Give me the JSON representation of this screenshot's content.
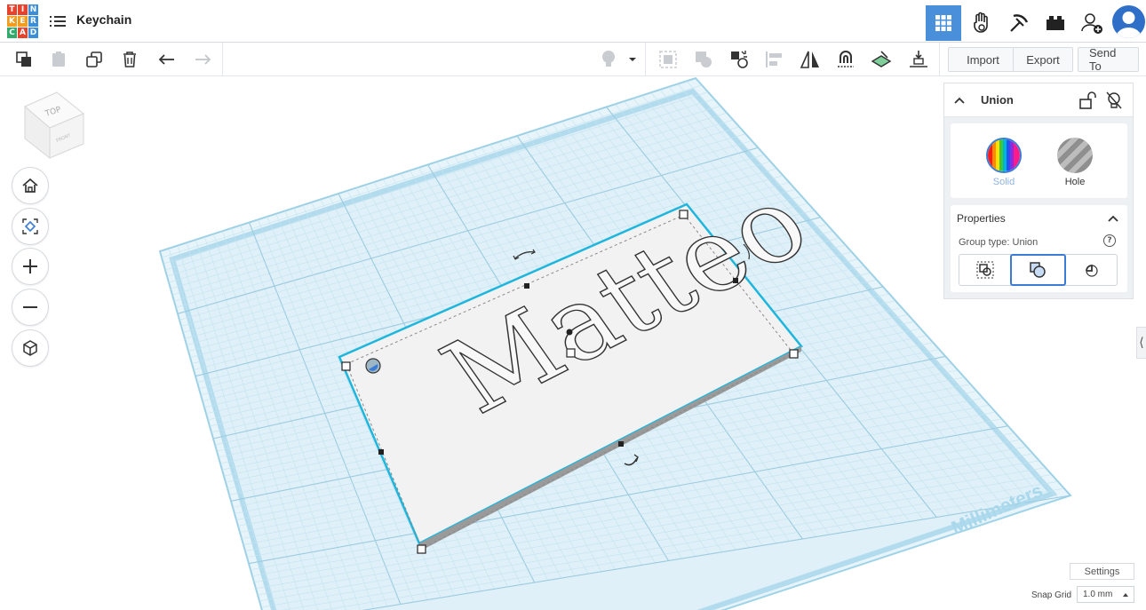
{
  "header": {
    "logo_letters": [
      "T",
      "I",
      "N",
      "K",
      "E",
      "R",
      "C",
      "A",
      "D"
    ],
    "logo_colors": [
      "#e8412c",
      "#e8412c",
      "#3b8fd8",
      "#f39c1e",
      "#f39c1e",
      "#3b8fd8",
      "#2fab6b",
      "#e8412c",
      "#3b8fd8"
    ],
    "title": "Keychain",
    "view_icons": [
      "grid-view-icon",
      "hand-sim-icon",
      "pickaxe-icon",
      "brick-icon",
      "add-user-icon",
      "user-avatar"
    ]
  },
  "toolbar": {
    "left_tools": [
      "copy-icon",
      "paste-icon",
      "duplicate-icon",
      "delete-icon",
      "undo-icon",
      "redo-icon"
    ],
    "right_tools": [
      "show-hide-icon",
      "dropdown-icon",
      "show-all-icon",
      "group-icon",
      "ungroup-icon",
      "align-icon",
      "mirror-icon",
      "cruise-icon",
      "workplane-icon",
      "drop-icon"
    ],
    "import_label": "Import",
    "export_label": "Export",
    "send_to_label": "Send To"
  },
  "workplane": {
    "units_label": "Millimeters",
    "viewcube_top": "TOP",
    "viewcube_front": "FRONT",
    "object_text": "Matteo"
  },
  "panel": {
    "shape_name": "Union",
    "solid_label": "Solid",
    "hole_label": "Hole",
    "properties_label": "Properties",
    "group_type_label": "Group type: Union",
    "group_type_options": [
      "hull-icon",
      "union-icon",
      "intersect-icon"
    ],
    "accent_color": "#3a7bd5"
  },
  "footer": {
    "settings_label": "Settings",
    "snap_grid_label": "Snap Grid",
    "snap_grid_value": "1.0 mm"
  }
}
